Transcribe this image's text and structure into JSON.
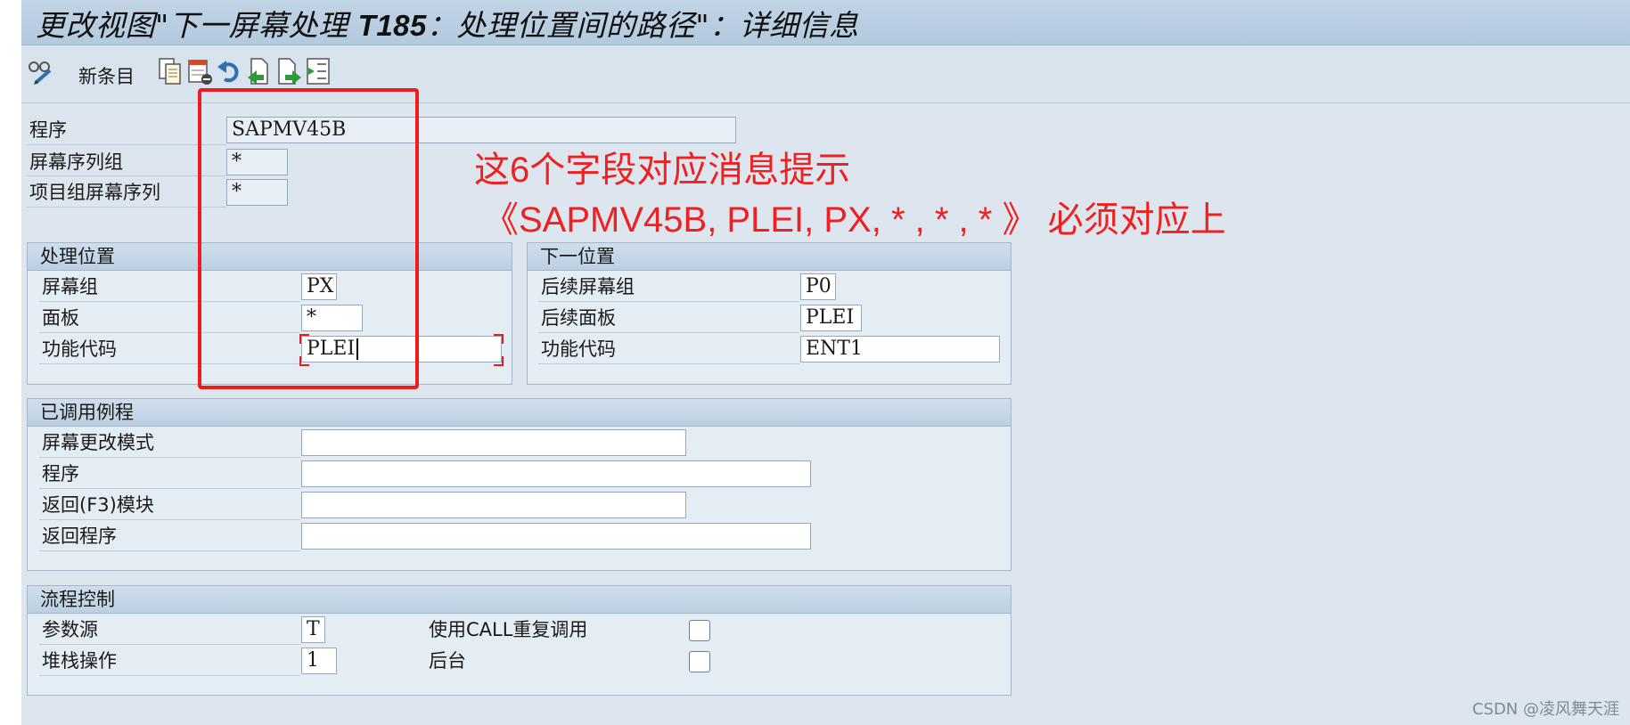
{
  "window": {
    "title_part1": "更改视图\"下一屏幕处理 ",
    "title_code": "T185",
    "title_part2": "：处理位置间的路径\"：详细信息"
  },
  "toolbar": {
    "icons": [
      "glasses-edit-icon",
      "copy-icon",
      "delete-icon",
      "undo-icon",
      "previous-entry-icon",
      "next-entry-icon",
      "select-block-icon"
    ],
    "new_entries_label": "新条目"
  },
  "header_fields": {
    "program_label": "程序",
    "program_value": "SAPMV45B",
    "screen_seq_group_label": "屏幕序列组",
    "screen_seq_group_value": "*",
    "item_group_screen_seq_label": "项目组屏幕序列",
    "item_group_screen_seq_value": "*"
  },
  "processing_position": {
    "title": "处理位置",
    "screen_group_label": "屏幕组",
    "screen_group_value": "PX",
    "panel_label": "面板",
    "panel_value": "*",
    "fcode_label": "功能代码",
    "fcode_value": "PLEI"
  },
  "next_position": {
    "title": "下一位置",
    "next_screen_group_label": "后续屏幕组",
    "next_screen_group_value": "P0",
    "next_panel_label": "后续面板",
    "next_panel_value": "PLEI",
    "fcode_label": "功能代码",
    "fcode_value": "ENT1"
  },
  "called_routines": {
    "title": "已调用例程",
    "screen_change_mode_label": "屏幕更改模式",
    "screen_change_mode_value": "",
    "program_label": "程序",
    "program_value": "",
    "back_module_label": "返回(F3)模块",
    "back_module_value": "",
    "back_program_label": "返回程序",
    "back_program_value": ""
  },
  "flow_control": {
    "title": "流程控制",
    "param_source_label": "参数源",
    "param_source_value": "T",
    "stack_op_label": "堆栈操作",
    "stack_op_value": "1",
    "use_call_label": "使用CALL重复调用",
    "use_call_checked": false,
    "background_label": "后台",
    "background_checked": false
  },
  "annotation": {
    "line1": "这6个字段对应消息提示",
    "line2": "《SAPMV45B, PLEI, PX, * , * , *   》 必须对应上",
    "color": "#ee2020"
  },
  "watermark": "CSDN @凌风舞天涯"
}
